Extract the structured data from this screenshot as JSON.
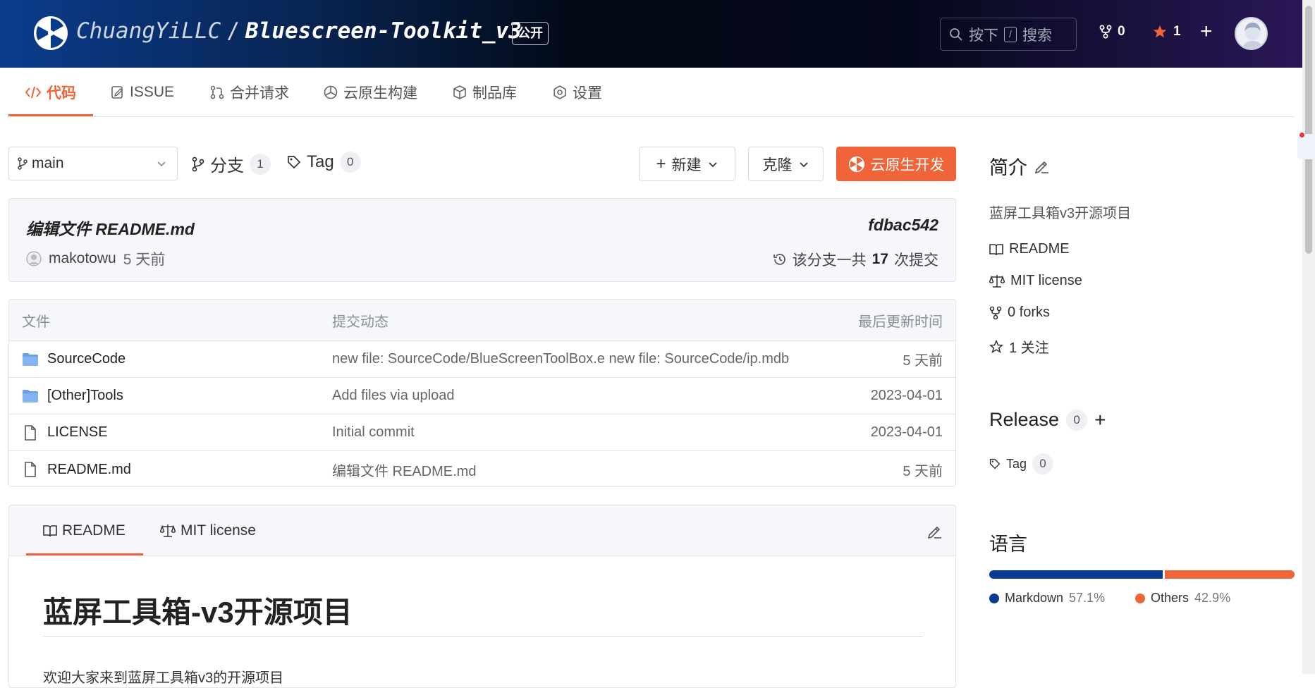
{
  "header": {
    "owner": "ChuangYiLLC",
    "separator": "/",
    "repo": "Bluescreen-Toolkit_v3",
    "visibility": "公开",
    "search": {
      "prefix": "按下",
      "key": "/",
      "suffix": "搜索"
    },
    "forks": "0",
    "stars": "1",
    "star_color": "#f0643a"
  },
  "tabs": [
    {
      "label": "代码",
      "icon": "code-icon"
    },
    {
      "label": "ISSUE",
      "icon": "issue-icon"
    },
    {
      "label": "合并请求",
      "icon": "pull-request-icon"
    },
    {
      "label": "云原生构建",
      "icon": "build-icon"
    },
    {
      "label": "制品库",
      "icon": "package-icon"
    },
    {
      "label": "设置",
      "icon": "gear-icon"
    }
  ],
  "branch_bar": {
    "branch": "main",
    "branches_label": "分支",
    "branches_count": "1",
    "tags_label": "Tag",
    "tags_count": "0",
    "new_label": "新建",
    "clone_label": "克隆",
    "dev_label": "云原生开发"
  },
  "commit": {
    "message": "编辑文件 README.md",
    "hash": "fdbac542",
    "author": "makotowu",
    "time": "5 天前",
    "count_prefix": "该分支一共",
    "count": "17",
    "count_suffix": "次提交"
  },
  "files": {
    "headers": {
      "name": "文件",
      "message": "提交动态",
      "time": "最后更新时间"
    },
    "rows": [
      {
        "type": "folder",
        "name": "SourceCode",
        "message": "new file: SourceCode/BlueScreenToolBox.e new file: SourceCode/ip.mdb",
        "time": "5 天前"
      },
      {
        "type": "folder",
        "name": "[Other]Tools",
        "message": "Add files via upload",
        "time": "2023-04-01"
      },
      {
        "type": "file",
        "name": "LICENSE",
        "message": "Initial commit",
        "time": "2023-04-01"
      },
      {
        "type": "file",
        "name": "README.md",
        "message": "编辑文件 README.md",
        "time": "5 天前"
      }
    ]
  },
  "readme": {
    "tab_readme": "README",
    "tab_license": "MIT license",
    "h1": "蓝屏工具箱-v3开源项目",
    "intro": "欢迎大家来到蓝屏工具箱v3的开源项目"
  },
  "sidebar": {
    "about_title": "简介",
    "description": "蓝屏工具箱v3开源项目",
    "links": [
      {
        "label": "README",
        "icon": "book-icon"
      },
      {
        "label": "MIT license",
        "icon": "scale-icon"
      },
      {
        "label": "0 forks",
        "icon": "fork-icon"
      },
      {
        "label": "1 关注",
        "icon": "star-outline-icon"
      }
    ],
    "release_title": "Release",
    "release_count": "0",
    "tag_label": "Tag",
    "tag_count": "0",
    "lang_title": "语言",
    "languages": [
      {
        "name": "Markdown",
        "percent": "57.1%",
        "value": 57.1,
        "color": "#0b3a94"
      },
      {
        "name": "Others",
        "percent": "42.9%",
        "value": 42.9,
        "color": "#f0643a"
      }
    ]
  }
}
